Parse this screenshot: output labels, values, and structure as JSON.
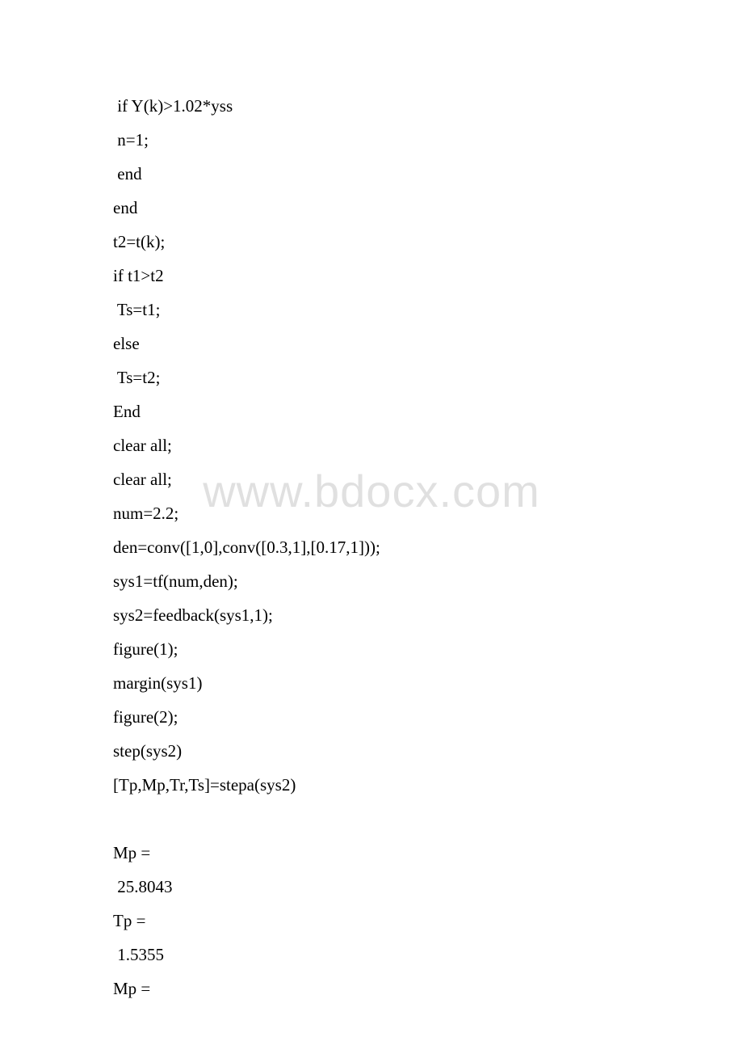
{
  "watermark": "www.bdocx.com",
  "lines": [
    {
      "text": " if Y(k)>1.02*yss",
      "cls": ""
    },
    {
      "text": " n=1;",
      "cls": ""
    },
    {
      "text": " end",
      "cls": ""
    },
    {
      "text": "end",
      "cls": ""
    },
    {
      "text": "t2=t(k);",
      "cls": ""
    },
    {
      "text": "if t1>t2",
      "cls": ""
    },
    {
      "text": " Ts=t1;",
      "cls": ""
    },
    {
      "text": "else",
      "cls": ""
    },
    {
      "text": " Ts=t2;",
      "cls": ""
    },
    {
      "text": "End",
      "cls": ""
    },
    {
      "text": "clear all;",
      "cls": ""
    },
    {
      "text": "clear all;",
      "cls": ""
    },
    {
      "text": "num=2.2;",
      "cls": ""
    },
    {
      "text": "den=conv([1,0],conv([0.3,1],[0.17,1]));",
      "cls": ""
    },
    {
      "text": "sys1=tf(num,den);",
      "cls": ""
    },
    {
      "text": "sys2=feedback(sys1,1);",
      "cls": ""
    },
    {
      "text": "figure(1);",
      "cls": ""
    },
    {
      "text": "margin(sys1)",
      "cls": ""
    },
    {
      "text": "figure(2);",
      "cls": ""
    },
    {
      "text": "step(sys2)",
      "cls": ""
    },
    {
      "text": "[Tp,Mp,Tr,Ts]=stepa(sys2)",
      "cls": ""
    },
    {
      "text": " ",
      "cls": ""
    },
    {
      "text": "Mp =",
      "cls": ""
    },
    {
      "text": " 25.8043",
      "cls": ""
    },
    {
      "text": "Tp =",
      "cls": ""
    },
    {
      "text": " 1.5355",
      "cls": ""
    },
    {
      "text": "Mp =",
      "cls": ""
    }
  ]
}
